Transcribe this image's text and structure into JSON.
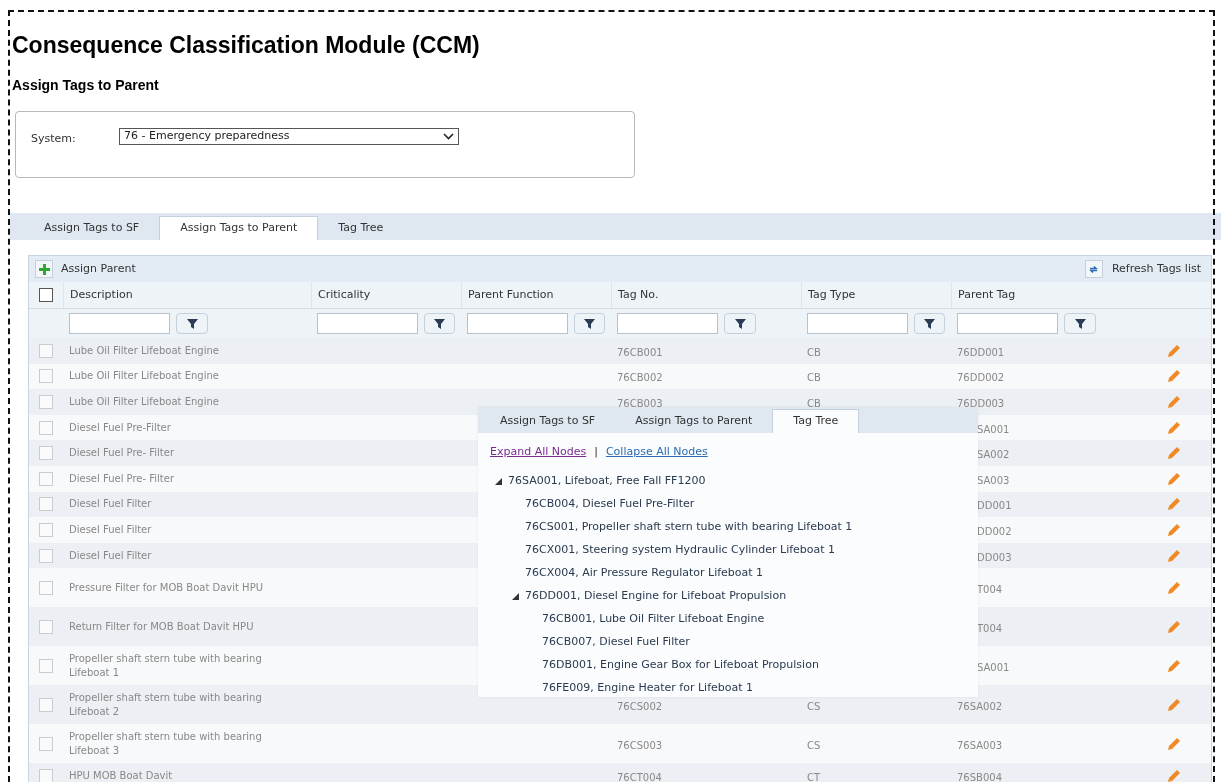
{
  "page": {
    "title": "Consequence Classification Module (CCM)",
    "subtitle": "Assign Tags to Parent"
  },
  "system": {
    "label": "System:",
    "value": "76 - Emergency preparedness"
  },
  "tabs": [
    {
      "label": "Assign Tags to SF",
      "selected": false
    },
    {
      "label": "Assign Tags to Parent",
      "selected": true
    },
    {
      "label": "Tag Tree",
      "selected": false
    }
  ],
  "toolbar": {
    "assign": "Assign Parent",
    "refresh": "Refresh Tags list"
  },
  "table": {
    "select_all": {
      "checked": false
    },
    "columns": [
      "Description",
      "Criticality",
      "Parent Function",
      "Tag No.",
      "Tag Type",
      "Parent Tag"
    ],
    "rows": [
      {
        "description": "Lube Oil Filter Lifeboat Engine",
        "tag_no": "76CB001",
        "tag_type": "CB",
        "parent_tag": "76DD001",
        "checked": false,
        "partly_hidden": false
      },
      {
        "description": "Lube Oil Filter Lifeboat Engine",
        "tag_no": "76CB002",
        "tag_type": "CB",
        "parent_tag": "76DD002",
        "checked": false,
        "partly_hidden": false
      },
      {
        "description": "Lube Oil Filter Lifeboat Engine",
        "tag_no": "76CB003",
        "tag_type": "CB",
        "parent_tag": "76DD003",
        "checked": false,
        "partly_hidden": false
      },
      {
        "description": "Diesel Fuel Pre-Filter",
        "parent_tag": "SA001",
        "checked": false,
        "partly_hidden": true
      },
      {
        "description": "Diesel Fuel Pre- Filter",
        "parent_tag": "SA002",
        "checked": false,
        "partly_hidden": true
      },
      {
        "description": "Diesel Fuel Pre- Filter",
        "parent_tag": "SA003",
        "checked": false,
        "partly_hidden": true
      },
      {
        "description": "Diesel Fuel Filter",
        "parent_tag": "DD001",
        "checked": false,
        "partly_hidden": true
      },
      {
        "description": "Diesel Fuel Filter",
        "parent_tag": "DD002",
        "checked": false,
        "partly_hidden": true
      },
      {
        "description": "Diesel Fuel Filter",
        "parent_tag": "DD003",
        "checked": false,
        "partly_hidden": true
      },
      {
        "description": "Pressure Filter for MOB Boat Davit HPU",
        "parent_tag": "T004",
        "checked": false,
        "partly_hidden": true
      },
      {
        "description": "Return Filter for MOB Boat Davit HPU",
        "parent_tag": "T004",
        "checked": false,
        "partly_hidden": true
      },
      {
        "description": "Propeller shaft stern tube with bearing Lifeboat 1",
        "parent_tag": "SA001",
        "checked": false,
        "partly_hidden": true
      },
      {
        "description": "Propeller shaft stern tube with bearing Lifeboat 2",
        "tag_no": "76CS002",
        "tag_type": "CS",
        "parent_tag": "76SA002",
        "checked": false,
        "partly_hidden": false
      },
      {
        "description": "Propeller shaft stern tube with bearing Lifeboat 3",
        "tag_no": "76CS003",
        "tag_type": "CS",
        "parent_tag": "76SA003",
        "checked": false,
        "partly_hidden": false
      },
      {
        "description": "HPU MOB Boat Davit",
        "tag_no": "76CT004",
        "tag_type": "CT",
        "parent_tag": "76SB004",
        "checked": false,
        "partly_hidden": false
      }
    ]
  },
  "overlay": {
    "tabs": [
      {
        "label": "Assign Tags to SF",
        "selected": false
      },
      {
        "label": "Assign Tags to Parent",
        "selected": false
      },
      {
        "label": "Tag Tree",
        "selected": true
      }
    ],
    "expand_link": "Expand All Nodes",
    "separator": "|",
    "collapse_link": "Collapse All Nodes",
    "tree": [
      {
        "label": "76SA001, Lifeboat, Free Fall FF1200",
        "expanded": true,
        "children": [
          {
            "label": "76CB004, Diesel Fuel Pre-Filter"
          },
          {
            "label": "76CS001, Propeller shaft stern tube with bearing Lifeboat 1"
          },
          {
            "label": "76CX001, Steering system Hydraulic Cylinder Lifeboat 1"
          },
          {
            "label": "76CX004, Air Pressure Regulator Lifeboat 1"
          },
          {
            "label": "76DD001, Diesel Engine for Lifeboat Propulsion",
            "expanded": true,
            "children": [
              {
                "label": "76CB001, Lube Oil Filter Lifeboat Engine"
              },
              {
                "label": "76CB007, Diesel Fuel Filter"
              },
              {
                "label": "76DB001, Engine Gear Box for Lifeboat Propulsion"
              },
              {
                "label": "76FE009, Engine Heater for Lifeboat 1"
              }
            ]
          }
        ]
      }
    ]
  }
}
